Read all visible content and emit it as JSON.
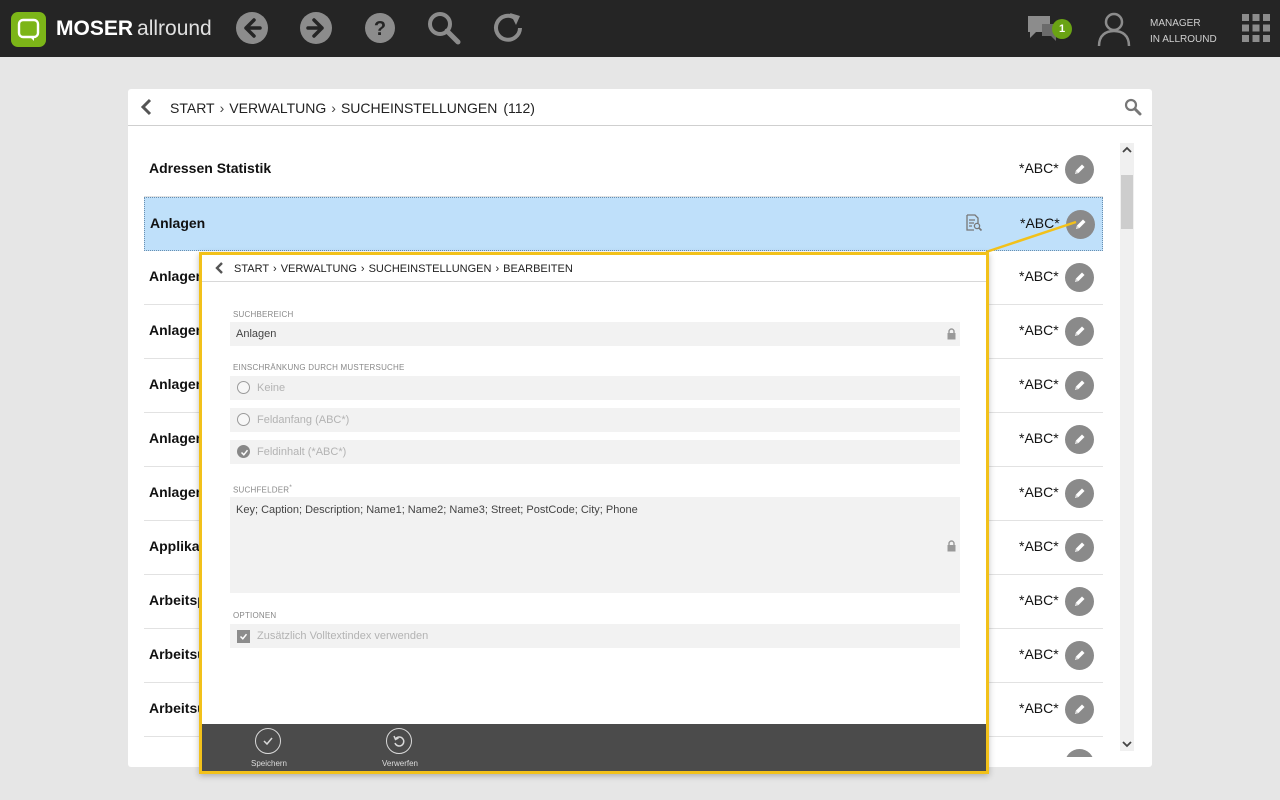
{
  "app": {
    "brand_bold": "MOSER",
    "brand_light": "allround",
    "notifications_count": "1",
    "user_line1": "MANAGER",
    "user_line2": "IN ALLROUND",
    "icons": [
      "back-arrow-icon",
      "forward-arrow-icon",
      "help-icon",
      "search-icon",
      "refresh-icon",
      "chat-icon",
      "user-icon",
      "apps-grid-icon"
    ]
  },
  "breadcrumb": {
    "items": [
      "START",
      "VERWALTUNG",
      "SUCHEINSTELLUNGEN"
    ],
    "count": "(112)"
  },
  "list": {
    "rows": [
      {
        "name": "Adressen Statistik",
        "mode": "*ABC*"
      },
      {
        "name": "Anlagen",
        "mode": "*ABC*"
      },
      {
        "name": "Anlagen",
        "mode": "*ABC*"
      },
      {
        "name": "Anlagen",
        "mode": "*ABC*"
      },
      {
        "name": "Anlagen",
        "mode": "*ABC*"
      },
      {
        "name": "Anlagen",
        "mode": "*ABC*"
      },
      {
        "name": "Anlagen",
        "mode": "*ABC*"
      },
      {
        "name": "Applikat",
        "mode": "*ABC*"
      },
      {
        "name": "Arbeitsp",
        "mode": "*ABC*"
      },
      {
        "name": "Arbeitsu",
        "mode": "*ABC*"
      },
      {
        "name": "Arbeitsu",
        "mode": "*ABC*"
      },
      {
        "name": "Arbeit",
        "mode": "*ABC*"
      }
    ]
  },
  "popup": {
    "breadcrumb": [
      "START",
      "VERWALTUNG",
      "SUCHEINSTELLUNGEN",
      "BEARBEITEN"
    ],
    "suchbereich_label": "SUCHBEREICH",
    "suchbereich_value": "Anlagen",
    "einschraenkung_label": "EINSCHRÄNKUNG DURCH MUSTERSUCHE",
    "options": [
      {
        "label": "Keine",
        "selected": false
      },
      {
        "label": "Feldanfang (ABC*)",
        "selected": false
      },
      {
        "label": "Feldinhalt (*ABC*)",
        "selected": true
      }
    ],
    "suchfelder_label": "SUCHFELDER",
    "suchfelder_marker": "*",
    "suchfelder_value": "Key; Caption; Description; Name1; Name2; Name3; Street; PostCode; City; Phone",
    "optionen_label": "OPTIONEN",
    "volltext_label": "Zusätzlich Volltextindex verwenden",
    "volltext_checked": true,
    "save_label": "Speichern",
    "discard_label": "Verwerfen"
  },
  "colors": {
    "topbar": "#252525",
    "accent_green": "#7cb518",
    "highlight_border": "#f2c11a",
    "selected_row": "#bfe0fa"
  }
}
